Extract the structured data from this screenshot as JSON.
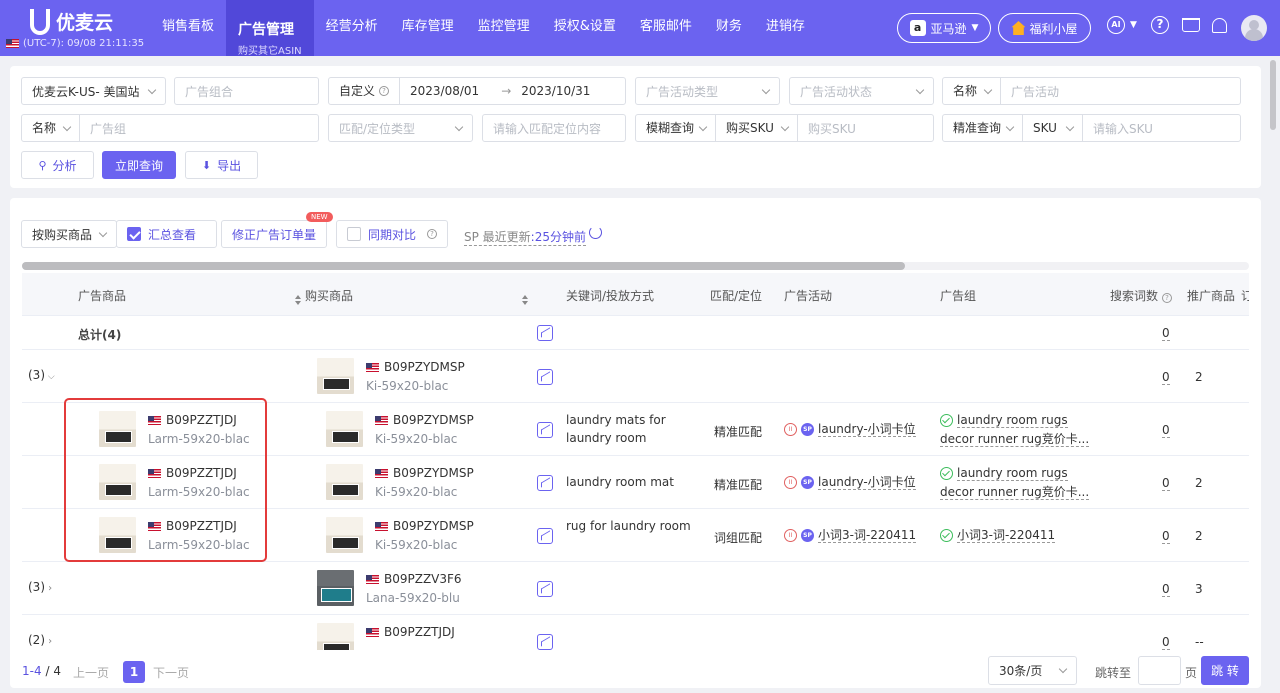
{
  "header": {
    "logo": "优麦云",
    "timezone": "(UTC-7): 09/08 21:11:35",
    "nav": [
      {
        "label": "销售看板"
      },
      {
        "label": "广告管理",
        "sub": "购买其它ASIN"
      },
      {
        "label": "经营分析"
      },
      {
        "label": "库存管理"
      },
      {
        "label": "监控管理"
      },
      {
        "label": "授权&设置"
      },
      {
        "label": "客服邮件"
      },
      {
        "label": "财务"
      },
      {
        "label": "进销存"
      }
    ],
    "marketplace": "亚马逊",
    "welfare": "福利小屋",
    "ai": "AI"
  },
  "filters": {
    "shop": "优麦云K-US- 美国站",
    "ad_group_combo_ph": "广告组合",
    "date_mode": "自定义",
    "date_start": "2023/08/01",
    "date_sep": "→",
    "date_end": "2023/10/31",
    "campaign_type_ph": "广告活动类型",
    "campaign_status_ph": "广告活动状态",
    "name_label_1": "名称",
    "campaign_ph": "广告活动",
    "name_label_2": "名称",
    "adgroup_ph": "广告组",
    "match_type_ph": "匹配/定位类型",
    "match_content_ph": "请输入匹配定位内容",
    "fuzzy": "模糊查询",
    "buy_sku_label": "购买SKU",
    "buy_sku_ph": "购买SKU",
    "exact": "精准查询",
    "sku_label": "SKU",
    "sku_ph": "请输入SKU",
    "analyze": "分析",
    "query": "立即查询",
    "export": "导出"
  },
  "toolbar": {
    "group_by": "按购买商品",
    "summary": "汇总查看",
    "fix_orders": "修正广告订单量",
    "new_badge": "NEW",
    "compare": "同期对比",
    "update_label": "SP 最近更新",
    "update_value": ":25分钟前"
  },
  "columns": [
    "广告商品",
    "购买商品",
    "关键词/投放方式",
    "匹配/定位",
    "广告活动",
    "广告组",
    "搜索词数",
    "推广商品",
    "订单"
  ],
  "total": {
    "label": "总计(4)",
    "search_terms": "0"
  },
  "groups": [
    {
      "count": "(3)",
      "buy_asin": "B09PZYDMSP",
      "buy_sku": "Ki-59x20-blac",
      "search_terms": "0",
      "promoted": "2"
    },
    {
      "count": "(3)",
      "buy_asin": "B09PZZV3F6",
      "buy_sku": "Lana-59x20-blu",
      "search_terms": "0",
      "promoted": "3"
    },
    {
      "count": "(2)",
      "buy_asin": "B09PZZTJDJ",
      "buy_sku": "",
      "search_terms": "0",
      "promoted": "--"
    }
  ],
  "rows": [
    {
      "ad_asin": "B09PZZTJDJ",
      "ad_sku": "Larm-59x20-blac",
      "buy_asin": "B09PZYDMSP",
      "buy_sku": "Ki-59x20-blac",
      "keyword": "laundry mats for",
      "keyword2": "laundry room",
      "match": "精准匹配",
      "campaign": "laundry-小词卡位",
      "adgroup": "laundry room rugs",
      "adgroup2": "decor runner rug竞价卡...",
      "search_terms": "0",
      "promoted": ""
    },
    {
      "ad_asin": "B09PZZTJDJ",
      "ad_sku": "Larm-59x20-blac",
      "buy_asin": "B09PZYDMSP",
      "buy_sku": "Ki-59x20-blac",
      "keyword": "laundry room mat",
      "keyword2": "",
      "match": "精准匹配",
      "campaign": "laundry-小词卡位",
      "adgroup": "laundry room rugs",
      "adgroup2": "decor runner rug竞价卡...",
      "search_terms": "0",
      "promoted": "2"
    },
    {
      "ad_asin": "B09PZZTJDJ",
      "ad_sku": "Larm-59x20-blac",
      "buy_asin": "B09PZYDMSP",
      "buy_sku": "Ki-59x20-blac",
      "keyword": "rug for laundry room",
      "keyword2": "",
      "match": "词组匹配",
      "campaign": "小词3-词-220411",
      "adgroup": "小词3-词-220411",
      "adgroup2": "",
      "search_terms": "0",
      "promoted": "2"
    }
  ],
  "pagination": {
    "range": "1-4",
    "sep": "/",
    "total": "4",
    "prev": "上一页",
    "page": "1",
    "next": "下一页",
    "per_page": "30条/页",
    "jump_label": "跳转至",
    "page_unit": "页",
    "jump_btn": "跳 转"
  },
  "colors": {
    "brand": "#6b63f0",
    "highlight": "#e33b3b"
  }
}
